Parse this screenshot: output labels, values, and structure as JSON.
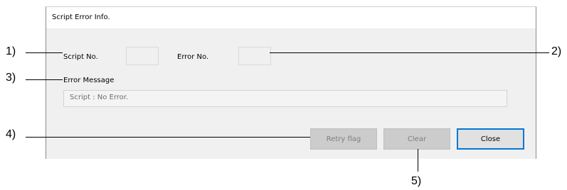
{
  "dialog": {
    "title": "Script Error Info.",
    "script_no_label": "Script No.",
    "script_no_value": "",
    "error_no_label": "Error No.",
    "error_no_value": "",
    "error_message_label": "Error Message",
    "error_message_value": "Script : No Error.",
    "buttons": {
      "retry": "Retry flag",
      "clear": "Clear",
      "close": "Close"
    }
  },
  "callouts": [
    "1)",
    "2)",
    "3)",
    "4)",
    "5)"
  ],
  "colors": {
    "dialog_bg": "#f0f0f0",
    "disabled_button": "#cccccc",
    "focus_border": "#0078d7"
  }
}
